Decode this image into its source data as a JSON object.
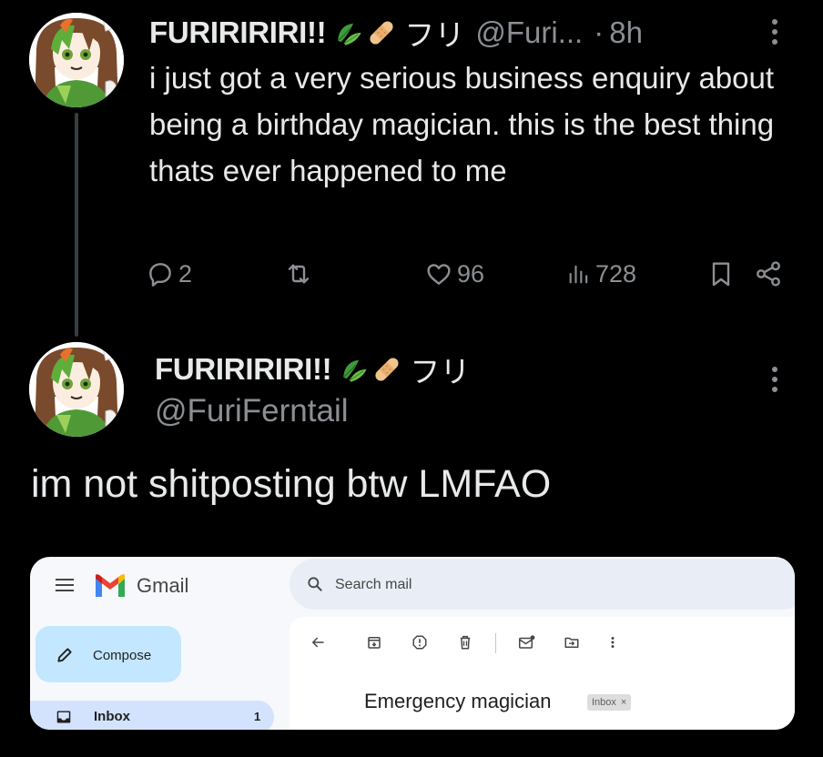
{
  "tweet1": {
    "name": "FURIRIRIRI!!",
    "kana": "フリ",
    "handle_truncated": "@Furi...",
    "separator": "·",
    "time": "8h",
    "body": "i just got a very serious business enquiry about being a birthday magician. this is the best thing thats ever happened to me",
    "actions": {
      "replies": "2",
      "retweets": "",
      "likes": "96",
      "views": "728"
    }
  },
  "tweet2": {
    "name": "FURIRIRIRI!!",
    "kana": "フリ",
    "handle": "@FuriFerntail",
    "body": "im not shitposting btw LMFAO"
  },
  "gmail_screenshot": {
    "app_name": "Gmail",
    "search_placeholder": "Search mail",
    "compose_label": "Compose",
    "inbox_label": "Inbox",
    "inbox_count": "1",
    "subject": "Emergency magician",
    "label_chip": "Inbox",
    "label_chip_close": "×"
  },
  "colors": {
    "background": "#000000",
    "text": "#e7e9ea",
    "muted": "#8b8f93",
    "gmail_bg": "#f6f8fc",
    "compose_bg": "#c2e7ff",
    "inbox_bg": "#d3e3fd"
  },
  "icons": [
    "leaf-emoji-icon",
    "bandage-emoji-icon",
    "kebab-menu-icon",
    "reply-icon",
    "retweet-icon",
    "like-icon",
    "views-icon",
    "bookmark-icon",
    "share-icon",
    "hamburger-icon",
    "gmail-logo-icon",
    "search-icon",
    "pencil-icon",
    "inbox-icon",
    "back-arrow-icon",
    "archive-icon",
    "report-spam-icon",
    "delete-icon",
    "mark-unread-icon",
    "move-to-icon",
    "more-icon"
  ]
}
